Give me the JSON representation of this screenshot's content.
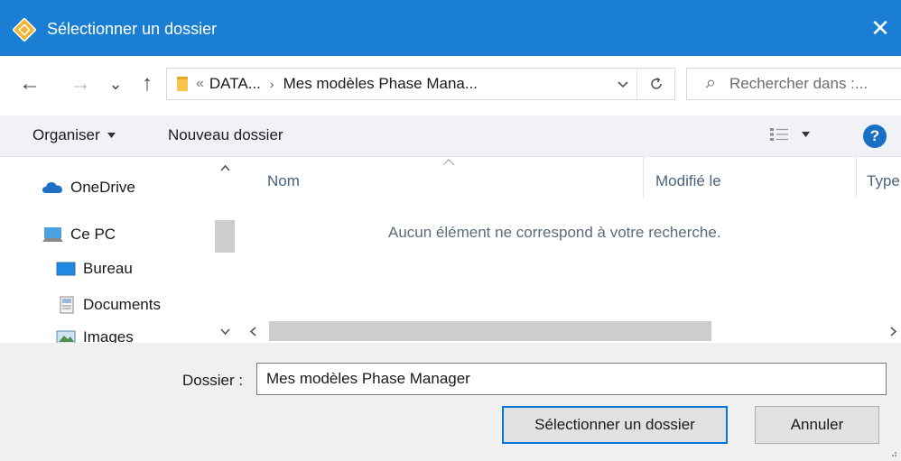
{
  "window": {
    "title": "Sélectionner un dossier",
    "close_glyph": "✕"
  },
  "nav": {
    "back_glyph": "←",
    "forward_glyph": "→",
    "recent_glyph": "⌄",
    "up_glyph": "↑",
    "breadcrumb_overflow": "«",
    "breadcrumb_parent": "DATA...",
    "breadcrumb_separator": "›",
    "breadcrumb_current": "Mes modèles Phase Mana...",
    "search_placeholder": "Rechercher dans :..."
  },
  "toolbar": {
    "organize_label": "Organiser",
    "new_folder_label": "Nouveau dossier",
    "help_glyph": "?"
  },
  "sidebar": {
    "items": [
      {
        "label": "OneDrive",
        "icon": "onedrive-icon"
      },
      {
        "label": "Ce PC",
        "icon": "computer-icon"
      },
      {
        "label": "Bureau",
        "icon": "desktop-icon"
      },
      {
        "label": "Documents",
        "icon": "documents-icon"
      },
      {
        "label": "Images",
        "icon": "images-icon"
      }
    ]
  },
  "list": {
    "columns": [
      "Nom",
      "Modifié le",
      "Type"
    ],
    "empty_message": "Aucun élément ne correspond à votre recherche."
  },
  "footer": {
    "folder_label": "Dossier :",
    "folder_value": "Mes modèles Phase Manager",
    "select_button": "Sélectionner un dossier",
    "cancel_button": "Annuler"
  },
  "colors": {
    "titlebar": "#1a7fd4",
    "accent": "#0078d7",
    "toolbar_bg": "#f0f2f5",
    "footer_bg": "#f0f0f0"
  }
}
